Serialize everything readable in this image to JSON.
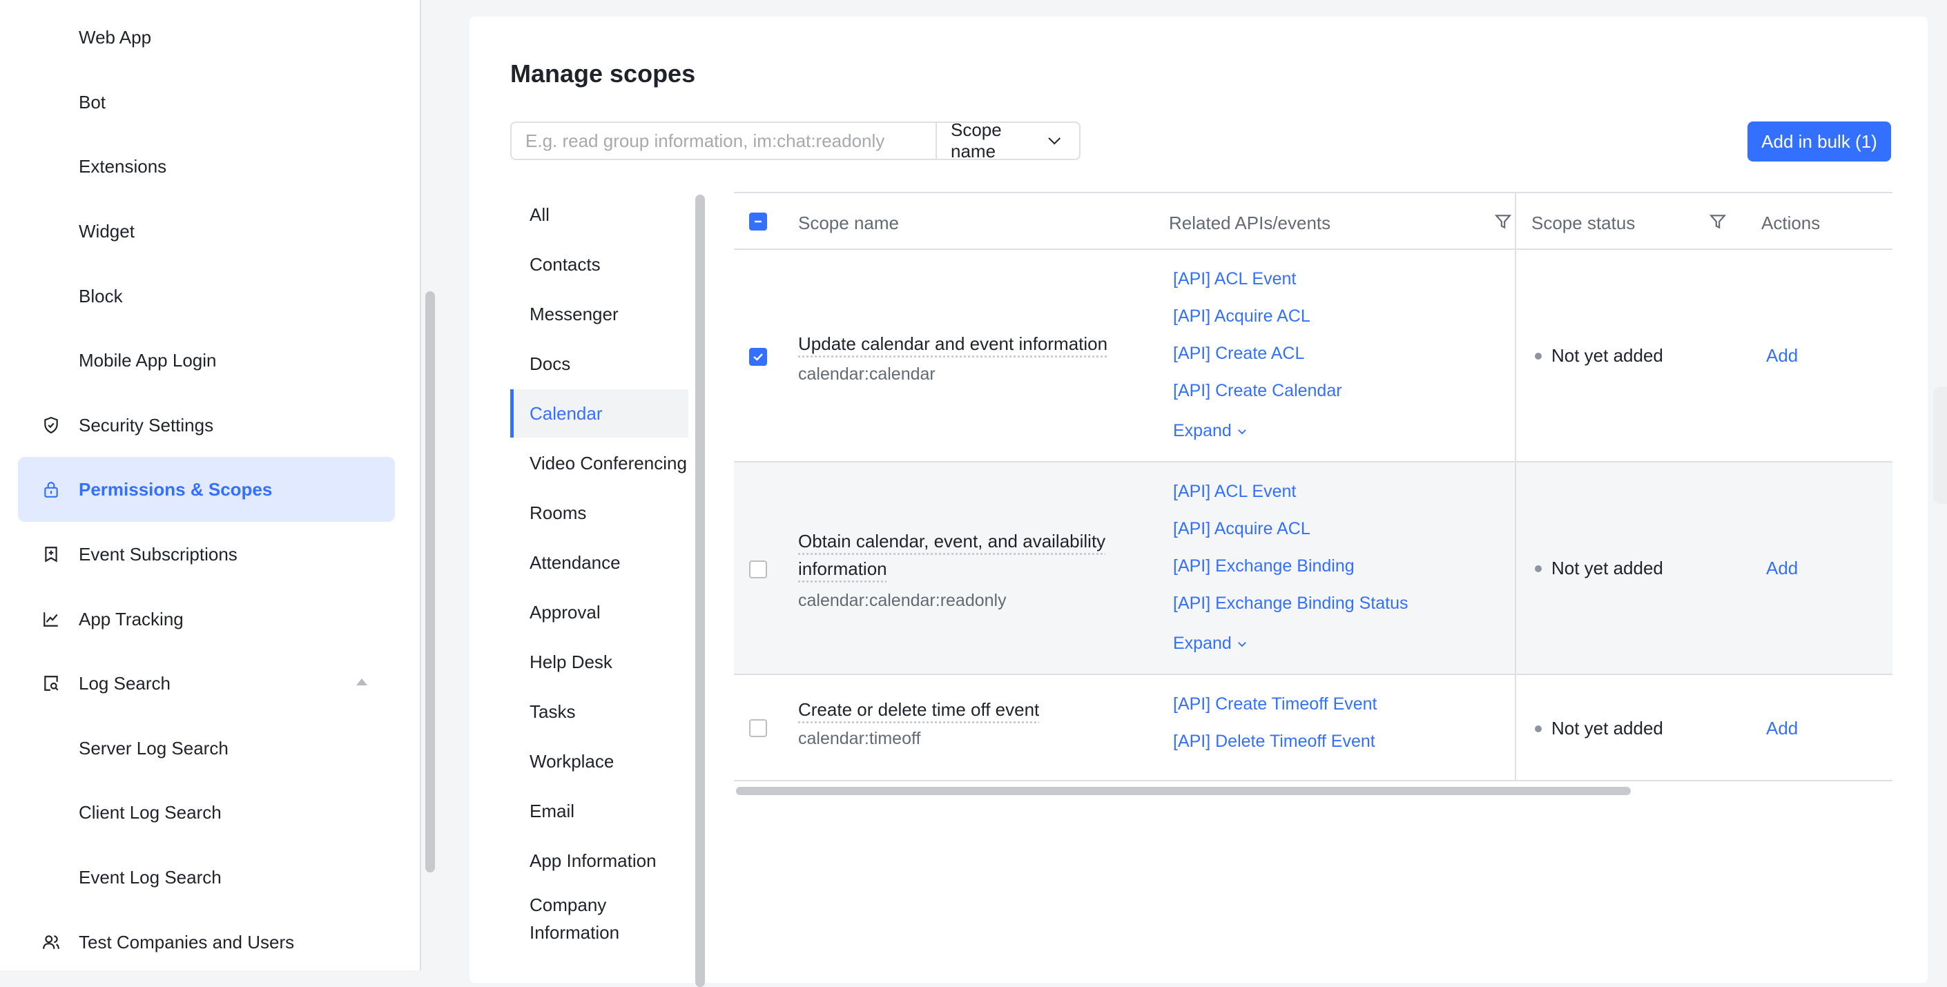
{
  "sidebar": {
    "items": [
      {
        "label": "Web App",
        "icon": ""
      },
      {
        "label": "Bot",
        "icon": ""
      },
      {
        "label": "Extensions",
        "icon": ""
      },
      {
        "label": "Widget",
        "icon": ""
      },
      {
        "label": "Block",
        "icon": ""
      },
      {
        "label": "Mobile App Login",
        "icon": ""
      },
      {
        "label": "Security Settings",
        "icon": "shield-icon"
      },
      {
        "label": "Permissions & Scopes",
        "icon": "lock-icon",
        "active": true
      },
      {
        "label": "Event Subscriptions",
        "icon": "subscription-icon"
      },
      {
        "label": "App Tracking",
        "icon": "chart-line-icon"
      },
      {
        "label": "Log Search",
        "icon": "log-search-icon"
      },
      {
        "label": "Server Log Search",
        "icon": ""
      },
      {
        "label": "Client Log Search",
        "icon": ""
      },
      {
        "label": "Event Log Search",
        "icon": ""
      },
      {
        "label": "Test Companies and Users",
        "icon": "users-icon"
      }
    ]
  },
  "main": {
    "title": "Manage scopes",
    "search": {
      "placeholder": "E.g. read group information, im:chat:readonly"
    },
    "scope_select": {
      "value": "Scope name"
    },
    "bulk_button": "Add in bulk (1)",
    "categories": [
      "All",
      "Contacts",
      "Messenger",
      "Docs",
      "Calendar",
      "Video Conferencing",
      "Rooms",
      "Attendance",
      "Approval",
      "Help Desk",
      "Tasks",
      "Workplace",
      "Email",
      "App Information",
      "Company Information"
    ],
    "active_category": "Calendar",
    "table": {
      "headers": {
        "scope_name": "Scope name",
        "related": "Related APIs/events",
        "status": "Scope status",
        "actions": "Actions"
      },
      "rows": [
        {
          "checked": true,
          "title": "Update calendar and event information",
          "key": "calendar:calendar",
          "apis": [
            "[API] ACL Event",
            "[API] Acquire ACL",
            "[API] Create ACL",
            "[API] Create Calendar"
          ],
          "expand": "Expand",
          "status": "Not yet added",
          "action": "Add"
        },
        {
          "checked": false,
          "title_line1": "Obtain calendar, event, and availability",
          "title_line2": "information",
          "key": "calendar:calendar:readonly",
          "apis": [
            "[API] ACL Event",
            "[API] Acquire ACL",
            "[API] Exchange Binding",
            "[API] Exchange Binding Status"
          ],
          "expand": "Expand",
          "status": "Not yet added",
          "action": "Add"
        },
        {
          "checked": false,
          "title": "Create or delete time off event",
          "key": "calendar:timeoff",
          "apis": [
            "[API] Create Timeoff Event",
            "[API] Delete Timeoff Event"
          ],
          "status": "Not yet added",
          "action": "Add"
        }
      ]
    }
  }
}
